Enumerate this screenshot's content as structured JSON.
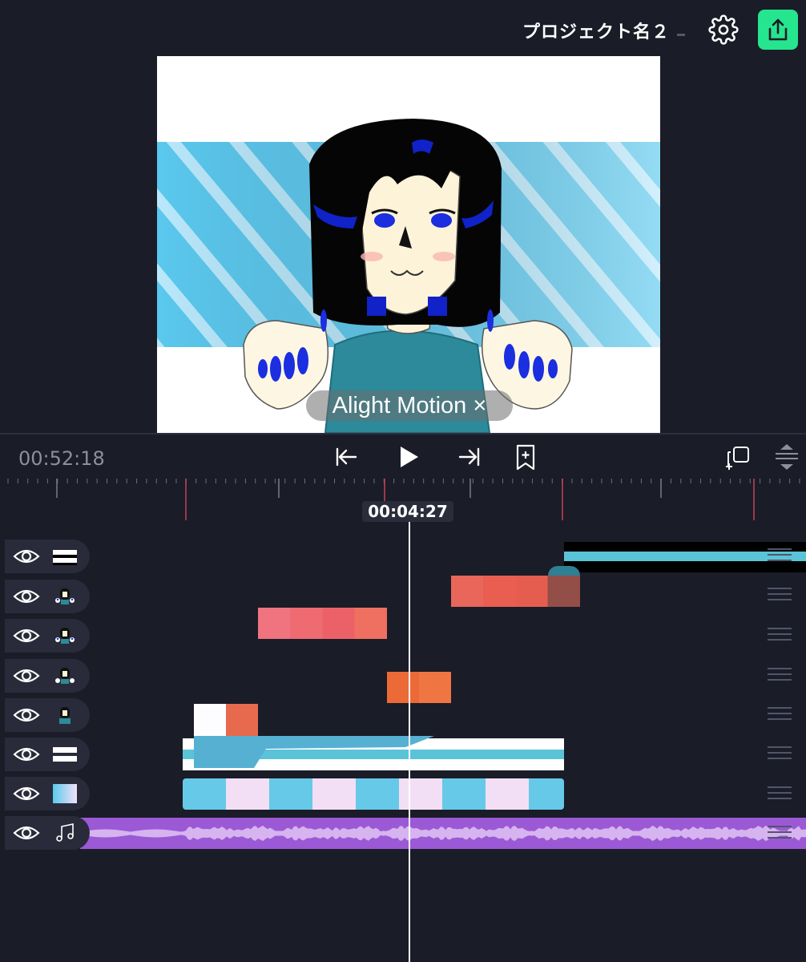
{
  "header": {
    "project_title": "プロジェクト名２",
    "settings_icon": "gear-icon",
    "export_icon": "share-export-icon",
    "export_color": "#25e58e"
  },
  "preview": {
    "watermark": "Alight Motion ×"
  },
  "transport": {
    "time": "00:52:18",
    "buttons": [
      "skip-to-start-icon",
      "play-icon",
      "skip-to-end-icon",
      "add-bookmark-icon",
      "duplicate-layer-icon",
      "collapse-icon"
    ]
  },
  "ruler": {
    "playhead_time": "00:04:27"
  },
  "tracks": [
    {
      "name": "shape-bars",
      "thumb": "bars-icon"
    },
    {
      "name": "character-1",
      "thumb": "character-thumbnail"
    },
    {
      "name": "character-2",
      "thumb": "character-thumbnail"
    },
    {
      "name": "character-3",
      "thumb": "character-thumbnail"
    },
    {
      "name": "character-4",
      "thumb": "character-thumbnail"
    },
    {
      "name": "shape-bars-2",
      "thumb": "bars-icon"
    },
    {
      "name": "background",
      "thumb": "gradient-thumbnail"
    },
    {
      "name": "audio",
      "thumb": "music-note-icon"
    }
  ],
  "colors": {
    "background": "#1a1c27",
    "track_panel": "#292b3a",
    "audio_clip": "#9b59d6",
    "clip_cyan": "#5bc3d8",
    "clip_salmon": "#e8665a",
    "clip_orange": "#ee7440"
  }
}
